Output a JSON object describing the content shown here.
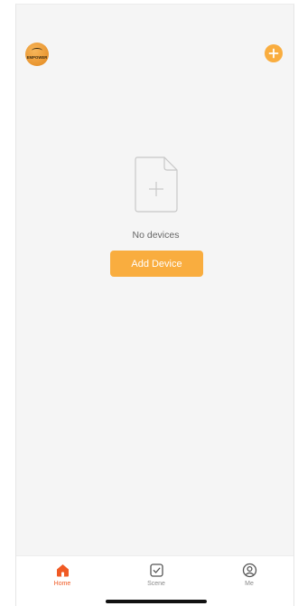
{
  "header": {
    "logo_text": "EMPOWER",
    "add_icon": "plus-circle-icon"
  },
  "empty_state": {
    "icon": "empty-document-icon",
    "message": "No devices",
    "button_label": "Add Device"
  },
  "tabbar": {
    "tabs": [
      {
        "label": "Home",
        "icon": "home-icon",
        "active": true
      },
      {
        "label": "Scene",
        "icon": "scene-check-icon",
        "active": false
      },
      {
        "label": "Me",
        "icon": "profile-icon",
        "active": false
      }
    ]
  },
  "colors": {
    "accent": "#f9ad3f",
    "active_tab": "#f05a24",
    "background": "#f5f5f5"
  }
}
